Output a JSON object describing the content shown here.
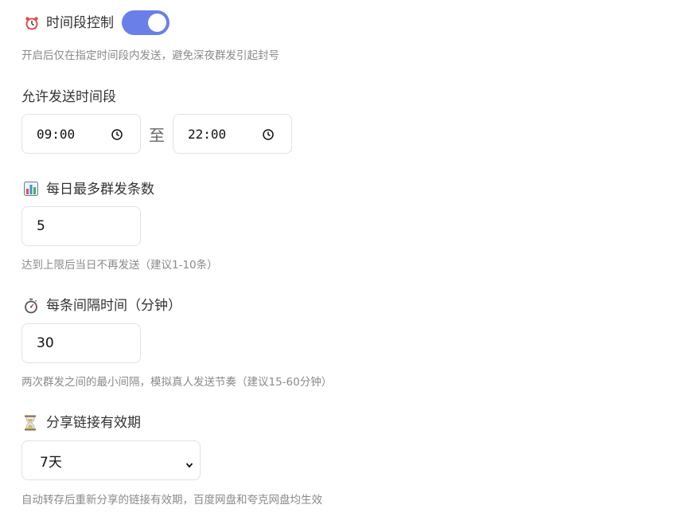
{
  "time_control": {
    "title": "时间段控制",
    "icon": "alarm-clock-icon",
    "enabled": true,
    "help": "开启后仅在指定时间段内发送，避免深夜群发引起封号",
    "accent": "#6b7fe8"
  },
  "allowed_period": {
    "title": "允许发送时间段",
    "start": "09:00",
    "separator": "至",
    "end": "22:00"
  },
  "daily_limit": {
    "title": "每日最多群发条数",
    "icon": "bar-chart-icon",
    "value": "5",
    "help": "达到上限后当日不再发送（建议1-10条）"
  },
  "interval": {
    "title": "每条间隔时间（分钟）",
    "icon": "stopwatch-icon",
    "value": "30",
    "help": "两次群发之间的最小间隔，模拟真人发送节奏（建议15-60分钟）"
  },
  "share_expiry": {
    "title": "分享链接有效期",
    "icon": "hourglass-icon",
    "selected": "7天",
    "help": "自动转存后重新分享的链接有效期，百度网盘和夸克网盘均生效"
  }
}
